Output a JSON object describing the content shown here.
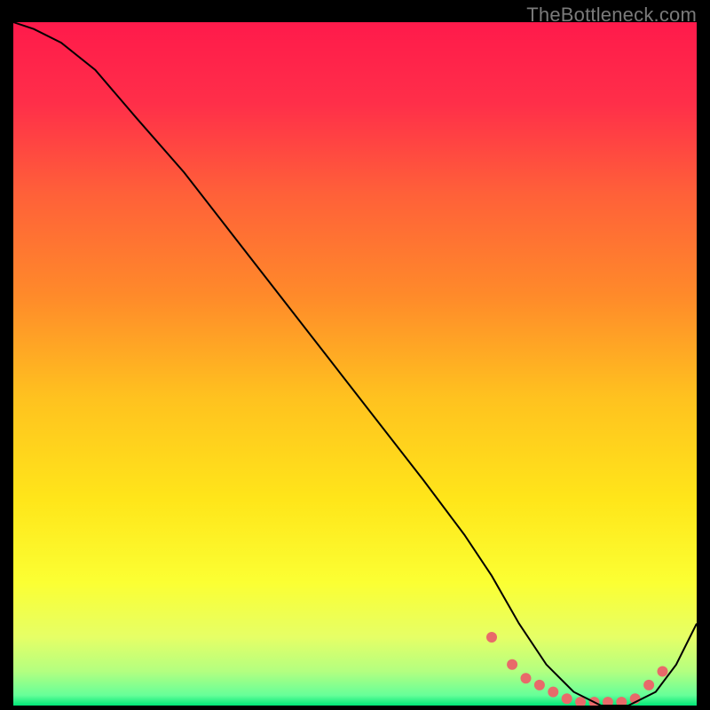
{
  "watermark": "TheBottleneck.com",
  "chart_data": {
    "type": "line",
    "title": "",
    "xlabel": "",
    "ylabel": "",
    "xlim": [
      0,
      100
    ],
    "ylim": [
      0,
      100
    ],
    "grid": false,
    "legend": false,
    "gradient_stops": [
      {
        "offset": 0.0,
        "color": "#ff1a4b"
      },
      {
        "offset": 0.12,
        "color": "#ff2f49"
      },
      {
        "offset": 0.25,
        "color": "#ff6039"
      },
      {
        "offset": 0.4,
        "color": "#ff8a2a"
      },
      {
        "offset": 0.55,
        "color": "#ffc21f"
      },
      {
        "offset": 0.7,
        "color": "#ffe61a"
      },
      {
        "offset": 0.82,
        "color": "#fbff33"
      },
      {
        "offset": 0.9,
        "color": "#e6ff66"
      },
      {
        "offset": 0.95,
        "color": "#b3ff80"
      },
      {
        "offset": 0.985,
        "color": "#66ff99"
      },
      {
        "offset": 1.0,
        "color": "#00e676"
      }
    ],
    "series": [
      {
        "name": "curve",
        "color": "#000000",
        "stroke_width": 2,
        "x": [
          0,
          3,
          7,
          12,
          18,
          25,
          32,
          39,
          46,
          53,
          60,
          66,
          70,
          74,
          78,
          82,
          86,
          90,
          94,
          97,
          100
        ],
        "y": [
          100,
          99,
          97,
          93,
          86,
          78,
          69,
          60,
          51,
          42,
          33,
          25,
          19,
          12,
          6,
          2,
          0,
          0,
          2,
          6,
          12
        ]
      }
    ],
    "markers": {
      "name": "bottom-cluster",
      "color": "#e86a6a",
      "radius": 6,
      "x": [
        70,
        73,
        75,
        77,
        79,
        81,
        83,
        85,
        87,
        89,
        91,
        93,
        95
      ],
      "y": [
        10,
        6,
        4,
        3,
        2,
        1,
        0.5,
        0.5,
        0.5,
        0.5,
        1,
        3,
        5
      ]
    }
  }
}
